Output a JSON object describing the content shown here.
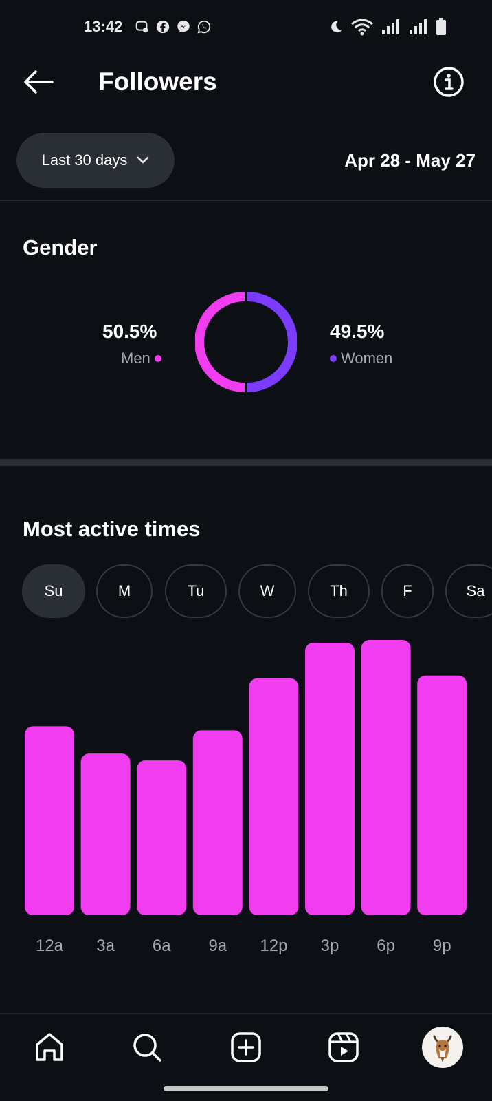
{
  "status_bar": {
    "time": "13:42",
    "left_icons": [
      "messenger-chat-icon",
      "facebook-icon",
      "messenger-icon",
      "whatsapp-icon"
    ],
    "right_icons": [
      "do-not-disturb-moon-icon",
      "wifi-icon",
      "signal-icon",
      "signal-icon",
      "battery-icon"
    ]
  },
  "header": {
    "title": "Followers",
    "back_icon": "arrow-left-icon",
    "info_icon": "info-icon"
  },
  "filter": {
    "range_label": "Last 30 days",
    "date_range": "Apr 28 - May 27"
  },
  "gender": {
    "title": "Gender",
    "men_pct": "50.5%",
    "men_label": "Men",
    "women_pct": "49.5%",
    "women_label": "Women",
    "colors": {
      "men": "#f23cf0",
      "women": "#7b3cff"
    }
  },
  "active_times": {
    "title": "Most active times",
    "days": [
      "Su",
      "M",
      "Tu",
      "W",
      "Th",
      "F",
      "Sa"
    ],
    "selected_day": "Su"
  },
  "chart_data": {
    "type": "bar",
    "categories": [
      "12a",
      "3a",
      "6a",
      "9a",
      "12p",
      "3p",
      "6p",
      "9p"
    ],
    "values": [
      69,
      59,
      56.5,
      67.5,
      86.5,
      99.5,
      100.5,
      87.5
    ],
    "ylim": [
      0,
      100.5
    ],
    "grid": false,
    "color": "#f23cf0"
  },
  "bottom_nav": [
    "home-icon",
    "search-icon",
    "create-post-icon",
    "reels-icon",
    "profile-avatar"
  ],
  "theme": {
    "background": "#0c0f14",
    "chip_bg": "#2a2f36",
    "muted_text": "#a6a9ae"
  }
}
